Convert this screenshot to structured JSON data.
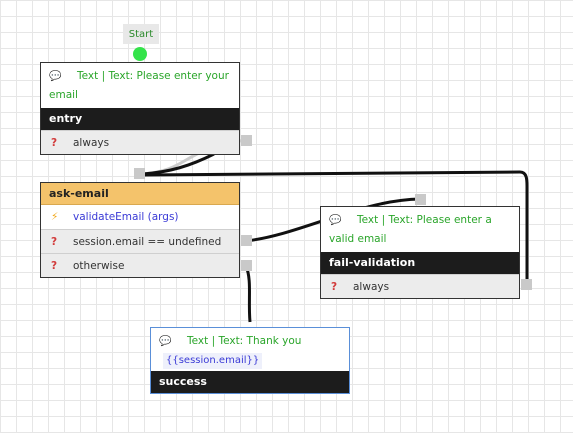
{
  "start": {
    "label": "Start"
  },
  "nodes": {
    "entry": {
      "message": "Text | Text: Please enter your email",
      "title": "entry",
      "conditions": [
        "always"
      ]
    },
    "ask_email": {
      "title": "ask-email",
      "action": "validateEmail (args)",
      "conditions": [
        "session.email == undefined",
        "otherwise"
      ]
    },
    "fail_validation": {
      "message": "Text | Text: Please enter a valid email",
      "title": "fail-validation",
      "conditions": [
        "always"
      ]
    },
    "success": {
      "message": "Text | Text: Thank you",
      "variable": "{{session.email}}",
      "title": "success"
    }
  },
  "icons": {
    "message": "speech-bubble-icon",
    "action": "lightning-icon",
    "condition": "question-mark-icon"
  },
  "colors": {
    "title_bar": "#1c1c1c",
    "active_title_bar": "#f4c36b",
    "message_text": "#2aa52a",
    "action_text": "#3a3ad6",
    "condition_icon": "#d23b3b",
    "start_dot": "#34e34a"
  }
}
